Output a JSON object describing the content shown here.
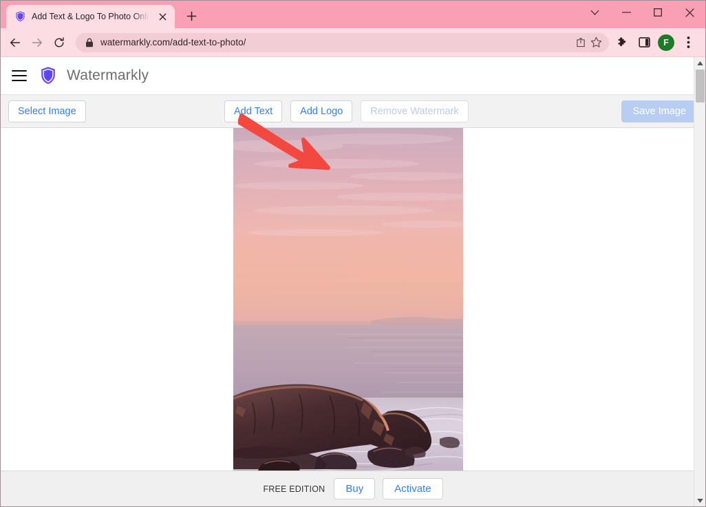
{
  "browser": {
    "tab": {
      "title": "Add Text & Logo To Photo Online",
      "favicon_icon": "shield-icon",
      "close_icon": "close-icon"
    },
    "new_tab_icon": "plus-icon",
    "window_controls": {
      "minimize_tabs_icon": "chevron-down-icon",
      "minimize_icon": "minimize-icon",
      "maximize_icon": "maximize-icon",
      "close_icon": "close-icon"
    },
    "nav": {
      "back_icon": "arrow-left-icon",
      "forward_icon": "arrow-right-icon",
      "reload_icon": "reload-icon"
    },
    "omnibox": {
      "lock_icon": "lock-icon",
      "url": "watermarkly.com/add-text-to-photo/",
      "share_icon": "share-icon",
      "bookmark_icon": "star-icon"
    },
    "actions": {
      "extensions_icon": "puzzle-icon",
      "sidepanel_icon": "side-panel-icon",
      "profile_initial": "F",
      "profile_color": "#1d7a26",
      "menu_icon": "three-dots-icon"
    }
  },
  "site": {
    "header": {
      "menu_icon": "hamburger-icon",
      "logo_icon": "shield-icon",
      "brand": "Watermarkly"
    },
    "toolbar": {
      "select_image": "Select Image",
      "add_text": "Add Text",
      "add_logo": "Add Logo",
      "remove_watermark": "Remove Watermark",
      "save_image": "Save Image"
    },
    "annotation": {
      "arrow_icon": "red-arrow-icon",
      "arrow_color": "#f2483f",
      "points_at": "Add Logo"
    },
    "canvas": {
      "image_alt": "Sunset seascape with rocky cliff and surf"
    },
    "footer": {
      "edition": "FREE EDITION",
      "buy": "Buy",
      "activate": "Activate"
    }
  },
  "scrollbar": {
    "up_icon": "caret-up-icon",
    "down_icon": "caret-down-icon"
  },
  "colors": {
    "browser_tabstrip": "#f9a0b5",
    "browser_toolbar": "#fbdde3",
    "link_blue": "#337ffb",
    "primary_btn": "#b8cdf2",
    "annotation_red": "#f2483f"
  }
}
